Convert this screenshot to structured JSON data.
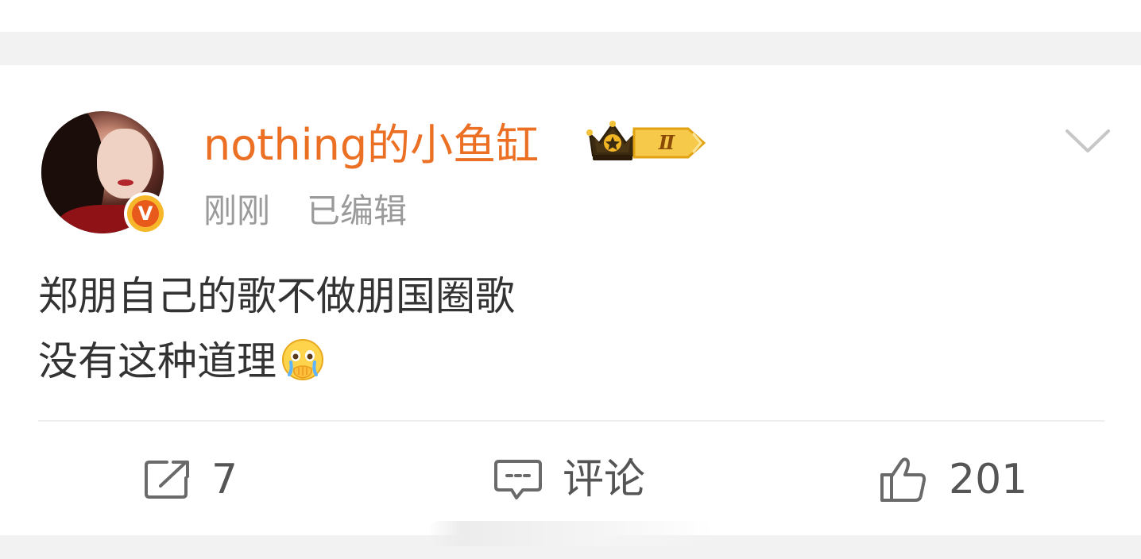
{
  "post": {
    "author": {
      "name": "nothing的小鱼缸",
      "avatar_icon": "avatar-photo",
      "verified_badge": "V",
      "level_badge": "Ⅱ",
      "badge_icon": "crown-icon"
    },
    "meta": {
      "time": "刚刚",
      "edited": "已编辑"
    },
    "content": {
      "line1": "郑朋自己的歌不做朋国圈歌",
      "line2": "没有这种道理",
      "emoji_icon": "covering-mouth-tearful-emoji"
    },
    "actions": {
      "repost_count": "7",
      "comment_label": "评论",
      "like_count": "201"
    }
  },
  "colors": {
    "username": "#eb7024",
    "meta": "#9a9a9a",
    "body": "#333333",
    "action": "#555555",
    "band": "#f2f2f2"
  }
}
